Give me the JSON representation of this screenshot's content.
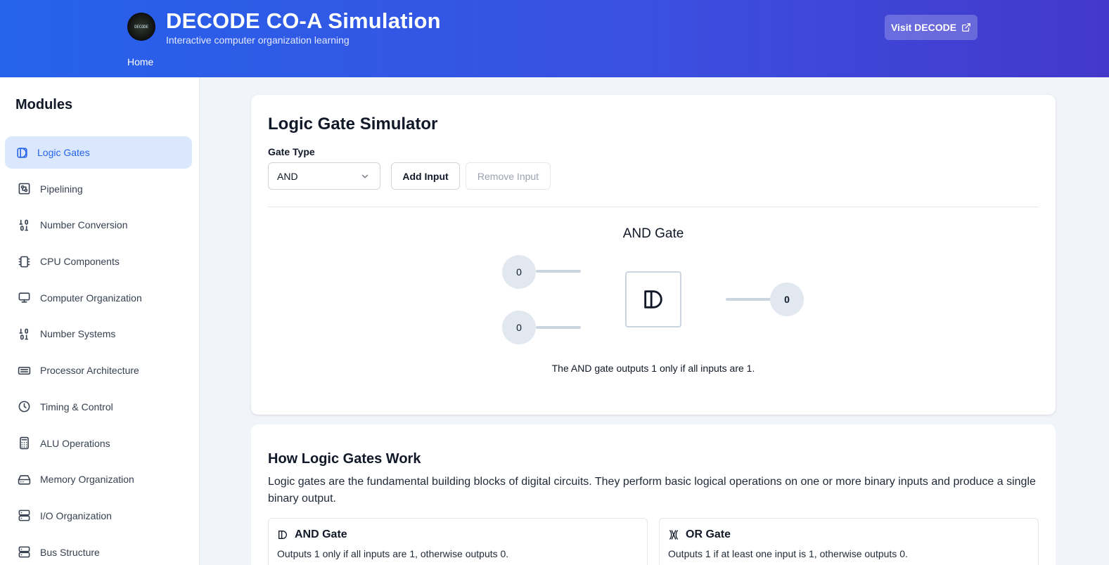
{
  "header": {
    "logo_text": "DECODE",
    "title": "DECODE CO-A Simulation",
    "subtitle": "Interactive computer organization learning",
    "nav_home": "Home",
    "visit_button": "Visit DECODE",
    "colors": {
      "gradient_start": "#2563eb",
      "gradient_end": "#4338ca"
    }
  },
  "sidebar": {
    "title": "Modules",
    "items": [
      {
        "label": "Logic Gates",
        "icon": "logic-gate-icon",
        "active": true
      },
      {
        "label": "Pipelining",
        "icon": "pipeline-icon"
      },
      {
        "label": "Number Conversion",
        "icon": "binary-icon"
      },
      {
        "label": "CPU Components",
        "icon": "chip-icon"
      },
      {
        "label": "Computer Organization",
        "icon": "monitor-icon"
      },
      {
        "label": "Number Systems",
        "icon": "binary-icon"
      },
      {
        "label": "Processor Architecture",
        "icon": "keyboard-icon"
      },
      {
        "label": "Timing & Control",
        "icon": "clock-icon"
      },
      {
        "label": "ALU Operations",
        "icon": "calculator-icon"
      },
      {
        "label": "Memory Organization",
        "icon": "hard-drive-icon"
      },
      {
        "label": "I/O Organization",
        "icon": "server-icon"
      },
      {
        "label": "Bus Structure",
        "icon": "server-icon"
      }
    ]
  },
  "simulator": {
    "title": "Logic Gate Simulator",
    "gate_type_label": "Gate Type",
    "gate_type_value": "AND",
    "add_input": "Add Input",
    "remove_input": "Remove Input",
    "gate_heading": "AND Gate",
    "inputs": [
      "0",
      "0"
    ],
    "output": "0",
    "description": "The AND gate outputs 1 only if all inputs are 1."
  },
  "how": {
    "title": "How Logic Gates Work",
    "text": "Logic gates are the fundamental building blocks of digital circuits. They perform basic logical operations on one or more binary inputs and produce a single binary output.",
    "cards": [
      {
        "name": "AND Gate",
        "icon": "and-gate-icon",
        "text": "Outputs 1 only if all inputs are 1, otherwise outputs 0."
      },
      {
        "name": "OR Gate",
        "icon": "or-gate-icon",
        "text": "Outputs 1 if at least one input is 1, otherwise outputs 0."
      }
    ]
  }
}
